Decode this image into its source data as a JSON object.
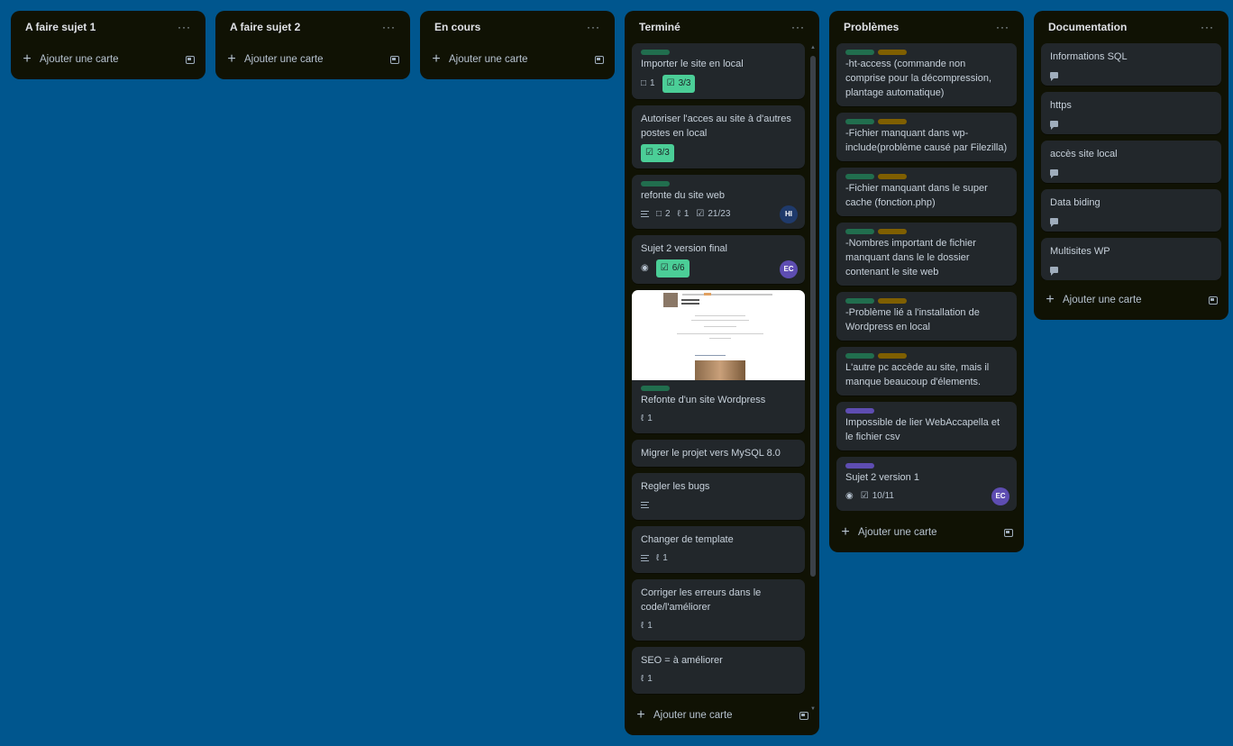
{
  "board": {
    "add_card_label": "Ajouter une carte",
    "menu_glyph": "···"
  },
  "lists": {
    "l1": {
      "title": "A faire sujet 1"
    },
    "l2": {
      "title": "A faire sujet 2"
    },
    "l3": {
      "title": "En cours"
    },
    "l4": {
      "title": "Terminé",
      "cards": [
        {
          "title": "Importer le site en local",
          "comments": "1",
          "checklist": "3/3"
        },
        {
          "title": "Autoriser l'acces au site à d'autres postes en local",
          "checklist": "3/3"
        },
        {
          "title": "refonte du site web",
          "comments": "2",
          "attachments": "1",
          "checklist": "21/23",
          "avatar": "HI"
        },
        {
          "title": "Sujet 2 version final",
          "checklist": "6/6",
          "avatar": "EC"
        },
        {
          "title": "Refonte d'un site Wordpress",
          "attachments": "1"
        },
        {
          "title": "Migrer le projet vers MySQL 8.0"
        },
        {
          "title": "Regler les bugs"
        },
        {
          "title": "Changer de template",
          "attachments": "1"
        },
        {
          "title": "Corriger les erreurs dans le code/l'améliorer",
          "attachments": "1"
        },
        {
          "title": "SEO = à améliorer",
          "attachments": "1"
        }
      ]
    },
    "l5": {
      "title": "Problèmes",
      "cards": [
        {
          "title": "-ht-access (commande non comprise pour la décompression, plantage automatique)"
        },
        {
          "title": "-Fichier manquant dans wp-include(problème causé par Filezilla)"
        },
        {
          "title": "-Fichier manquant dans le super cache (fonction.php)"
        },
        {
          "title": "-Nombres important de fichier manquant dans le le dossier contenant le site web"
        },
        {
          "title": "-Problème lié a l'installation de Wordpress en local"
        },
        {
          "title": "L'autre pc accède au site, mais il manque beaucoup d'élements."
        },
        {
          "title": "Impossible de lier WebAccapella et le fichier csv"
        },
        {
          "title": "Sujet 2 version 1",
          "checklist": "10/11",
          "avatar": "EC"
        }
      ]
    },
    "l6": {
      "title": "Documentation",
      "cards": [
        {
          "title": "Informations SQL"
        },
        {
          "title": "https"
        },
        {
          "title": "accès site local"
        },
        {
          "title": "Data biding"
        },
        {
          "title": "Multisites WP"
        }
      ]
    }
  },
  "colors": {
    "board_bg": "#00568e",
    "list_bg": "#101204",
    "card_bg": "#22272b",
    "label_green": "#216e4e",
    "label_yellow": "#7f5f01",
    "label_purple": "#5e4db2",
    "checklist_done": "#4bce97",
    "avatar_hi": "#1f3a6b",
    "avatar_ec": "#5e4db2"
  },
  "icons": [
    "more-icon",
    "plus-icon",
    "template-icon",
    "comment-icon",
    "checklist-icon",
    "attachment-icon",
    "description-icon",
    "watch-icon"
  ]
}
